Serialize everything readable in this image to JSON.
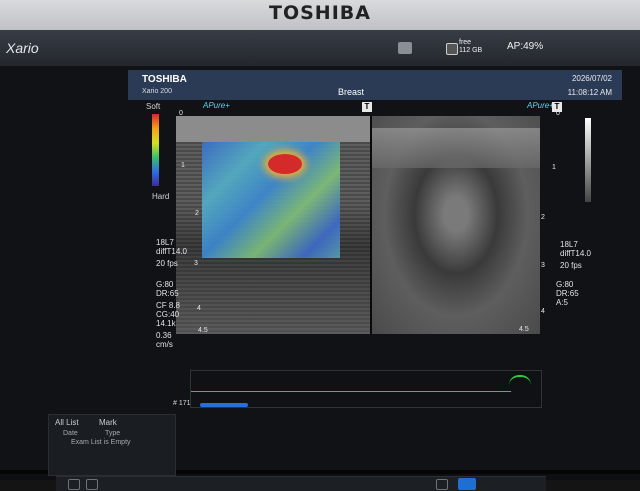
{
  "bezel": {
    "brand": "TOSHIBA"
  },
  "topbar": {
    "app": "Xario",
    "disk_status": "free",
    "disk_free": "112 GB",
    "ap": "AP:49%"
  },
  "info": {
    "manufacturer": "TOSHIBA",
    "model": "Xario 200",
    "preset": "Breast",
    "date": "2026/07/02",
    "time": "11:08:12 AM"
  },
  "elasto": {
    "soft": "Soft",
    "hard": "Hard"
  },
  "image_mode": "APure+",
  "left_params": [
    "18L7",
    "diffT14.0",
    "20 fps",
    "G:80",
    "DR:65",
    "CF 8.8",
    "CG:40",
    "14.1k",
    "0.36",
    "cm/s"
  ],
  "right_params": [
    "18L7",
    "diffT14.0",
    "20 fps",
    "G:80",
    "DR:65",
    "A:5"
  ],
  "depth_ticks": [
    "0",
    "1",
    "2",
    "3",
    "4",
    "4.5"
  ],
  "doppler": {
    "frame_label": "# 171"
  },
  "exam_list": {
    "all_list": "All List",
    "mark": "Mark",
    "col_date": "Date",
    "col_type": "Type",
    "empty": "Exam List is Empty"
  }
}
